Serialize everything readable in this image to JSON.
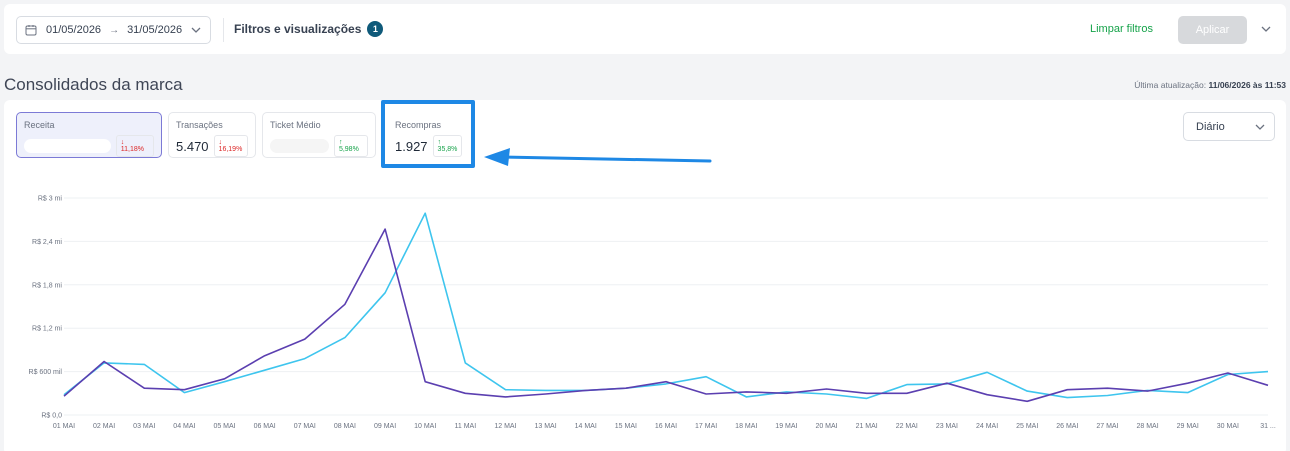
{
  "topbar": {
    "date_start": "01/05/2026",
    "date_arrow": "→",
    "date_end": "31/05/2026",
    "filters_label": "Filtros e visualizações",
    "filters_count": "1",
    "clear_filters": "Limpar filtros",
    "apply": "Aplicar"
  },
  "section": {
    "title": "Consolidados da marca",
    "last_update_label": "Última atualização:",
    "last_update_value": "11/06/2026 às 11:53"
  },
  "kpis": [
    {
      "label": "Receita",
      "value": "",
      "delta": "↓ 11,18%",
      "direction": "down",
      "active": true
    },
    {
      "label": "Transações",
      "value": "5.470",
      "delta": "↓ 16,19%",
      "direction": "down",
      "active": false
    },
    {
      "label": "Ticket Médio",
      "value": "",
      "delta": "↑ 5,98%",
      "direction": "up",
      "active": false
    },
    {
      "label": "Recompras",
      "value": "1.927",
      "delta": "↑ 35,8%",
      "direction": "up",
      "active": false
    }
  ],
  "period_select": {
    "value": "Diário"
  },
  "colors": {
    "series_current": "#5b3fb0",
    "series_previous": "#3ec5ee",
    "accent_green": "#16a34a",
    "highlight": "#1e88e5"
  },
  "chart_data": {
    "type": "line",
    "y_tick_labels": [
      "R$ 0,0",
      "R$ 600 mil",
      "R$ 1,2 mi",
      "R$ 1,8 mi",
      "R$ 2,4 mi",
      "R$ 3 mi"
    ],
    "ylim": [
      0,
      3000000
    ],
    "x": [
      "01 MAI",
      "02 MAI",
      "03 MAI",
      "04 MAI",
      "05 MAI",
      "06 MAI",
      "07 MAI",
      "08 MAI",
      "09 MAI",
      "10 MAI",
      "11 MAI",
      "12 MAI",
      "13 MAI",
      "14 MAI",
      "15 MAI",
      "16 MAI",
      "17 MAI",
      "18 MAI",
      "19 MAI",
      "20 MAI",
      "21 MAI",
      "22 MAI",
      "23 MAI",
      "24 MAI",
      "25 MAI",
      "26 MAI",
      "27 MAI",
      "28 MAI",
      "29 MAI",
      "30 MAI",
      "31 ..."
    ],
    "series": [
      {
        "values": [
          260000,
          740000,
          370000,
          350000,
          500000,
          820000,
          1050000,
          1530000,
          2570000,
          460000,
          300000,
          250000,
          290000,
          340000,
          370000,
          460000,
          290000,
          320000,
          300000,
          360000,
          300000,
          300000,
          440000,
          280000,
          190000,
          350000,
          370000,
          330000,
          440000,
          580000,
          410000
        ],
        "color": "#5b3fb0"
      },
      {
        "values": [
          280000,
          720000,
          700000,
          310000,
          460000,
          620000,
          780000,
          1070000,
          1690000,
          2790000,
          720000,
          350000,
          340000,
          340000,
          370000,
          430000,
          530000,
          250000,
          320000,
          290000,
          230000,
          420000,
          430000,
          590000,
          330000,
          240000,
          270000,
          340000,
          310000,
          560000,
          600000
        ],
        "color": "#3ec5ee"
      }
    ]
  }
}
